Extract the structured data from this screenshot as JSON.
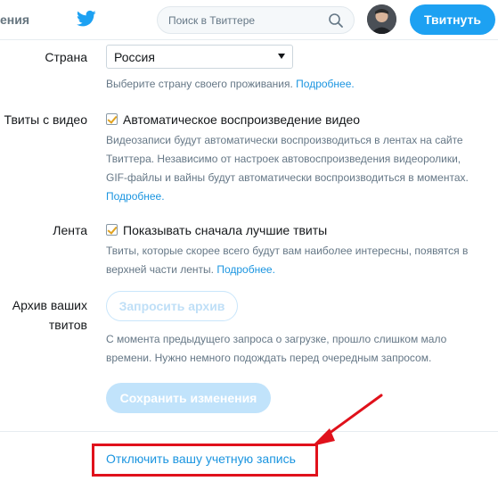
{
  "header": {
    "nav_fragment": "ения",
    "search_placeholder": "Поиск в Твиттере",
    "tweet_button": "Твитнуть"
  },
  "settings": {
    "country": {
      "label": "Страна",
      "selected": "Россия",
      "desc_text": "Выберите страну своего проживания. ",
      "desc_link": "Подробнее."
    },
    "video": {
      "label": "Твиты с видео",
      "checkbox_label": "Автоматическое воспроизведение видео",
      "checked": true,
      "desc_line1": "Видеозаписи будут автоматически воспроизводиться в лентах на сайте",
      "desc_line2": "Твиттера. Независимо от настроек автовоспроизведения видеоролики,",
      "desc_line3": "GIF-файлы и вайны будут автоматически воспроизводиться в моментах.",
      "desc_link": "Подробнее."
    },
    "timeline": {
      "label": "Лента",
      "checkbox_label": "Показывать сначала лучшие твиты",
      "checked": true,
      "desc_line1": "Твиты, которые скорее всего будут вам наиболее интересны, появятся в",
      "desc_line2": "верхней части ленты. ",
      "desc_link": "Подробнее."
    },
    "archive": {
      "label_line1": "Архив ваших",
      "label_line2": "твитов",
      "button": "Запросить архив",
      "desc_line1": "С момента предыдущего запроса о загрузке, прошло слишком мало",
      "desc_line2": "времени. Нужно немного подождать перед очередным запросом."
    },
    "save_button": "Сохранить изменения",
    "deactivate_link": "Отключить вашу учетную запись"
  },
  "colors": {
    "accent": "#1da1f2",
    "link": "#1b95e0",
    "highlight_box": "#e0111b"
  }
}
